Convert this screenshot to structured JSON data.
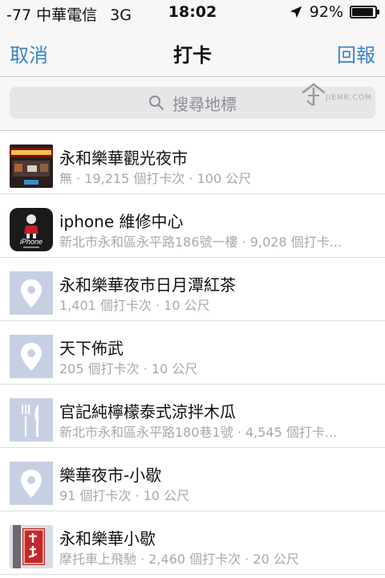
{
  "status": {
    "signal": "-77",
    "carrier": "中華電信",
    "network": "3G",
    "time": "18:02",
    "battery": "92%",
    "battery_fraction": 0.92
  },
  "nav": {
    "cancel_label": "取消",
    "title": "打卡",
    "report_label": "回報"
  },
  "search": {
    "placeholder": "搜尋地標",
    "watermark": "JIEMR.COM"
  },
  "colors": {
    "accent": "#3a83c9",
    "placeholder_bg": "#c7d0e3",
    "subtitle": "#a9a9ad"
  },
  "places": [
    {
      "name": "永和樂華觀光夜市",
      "detail": "無 · 19,215 個打卡次 · 100 公尺",
      "icon": "night-market-photo"
    },
    {
      "name": "iphone 維修中心",
      "detail": "新北市永和區永平路186號一樓 · 9,028 個打卡...",
      "icon": "iphone-repair-logo"
    },
    {
      "name": "永和樂華夜市日月潭紅茶",
      "detail": "1,401 個打卡次 · 10 公尺",
      "icon": "location-pin-icon"
    },
    {
      "name": "天下佈武",
      "detail": "205 個打卡次 · 10 公尺",
      "icon": "location-pin-icon"
    },
    {
      "name": "官記純檸檬泰式涼拌木瓜",
      "detail": "新北市永和區永平路180巷1號 · 4,545 個打卡...",
      "icon": "fork-knife-icon"
    },
    {
      "name": "樂華夜市-小歇",
      "detail": "91 個打卡次 · 10 公尺",
      "icon": "location-pin-icon"
    },
    {
      "name": "永和樂華小歇",
      "detail": "摩托車上飛馳 · 2,460 個打卡次 · 20 公尺",
      "icon": "shop-sign-photo"
    }
  ]
}
